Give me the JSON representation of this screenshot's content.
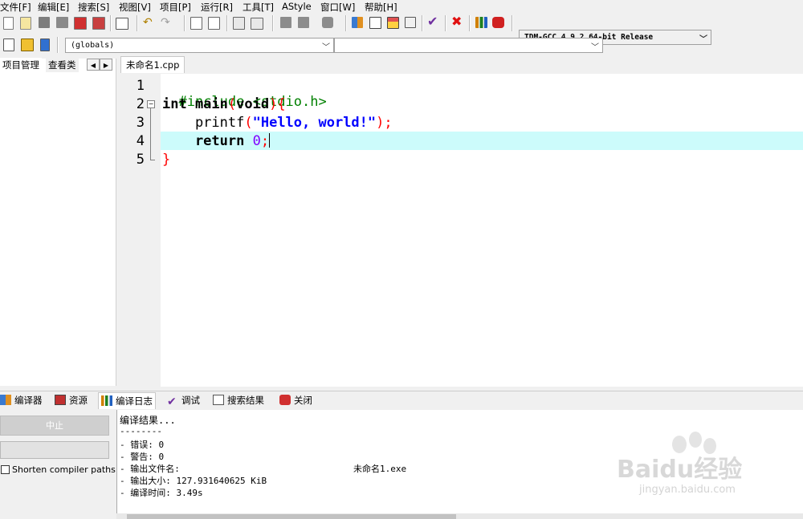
{
  "menu": [
    "文件[F]",
    "编辑[E]",
    "搜索[S]",
    "视图[V]",
    "项目[P]",
    "运行[R]",
    "工具[T]",
    "AStyle",
    "窗口[W]",
    "帮助[H]"
  ],
  "toolbar": {
    "compiler_select": "TDM-GCC 4.9.2 64-bit Release",
    "scope_select": "(globals)",
    "member_select": ""
  },
  "left_panel": {
    "tabs": [
      "项目管理",
      "查看类"
    ]
  },
  "editor": {
    "file_tab": "未命名1.cpp",
    "line_numbers": [
      "1",
      "2",
      "3",
      "4",
      "5"
    ],
    "lines": [
      {
        "t1": "#include <stdio.h>"
      },
      {
        "t1": "int main",
        "t2": "(",
        "t3": "void",
        "t4": ")",
        "t5": "{"
      },
      {
        "t1": "    printf",
        "t2": "(",
        "t3": "\"Hello, world!\"",
        "t4": ");"
      },
      {
        "t1": "    return ",
        "t2": "0",
        "t3": ";"
      },
      {
        "t1": "}"
      }
    ]
  },
  "bottom": {
    "tabs": [
      "编译器",
      "资源",
      "编译日志",
      "调试",
      "搜索结果",
      "关闭"
    ],
    "active_tab": "编译日志",
    "stop_button": "中止",
    "shorten_paths_label": "Shorten compiler paths",
    "shorten_paths_checked": false,
    "log": [
      "编译结果...",
      "--------",
      "- 错误: 0",
      "- 警告: 0",
      "- 输出文件名:",
      "- 输出大小: 127.931640625 KiB",
      "- 编译时间: 3.49s"
    ],
    "output_filename": "未命名1.exe"
  },
  "watermark": {
    "brand": "Baidu经验",
    "url": "jingyan.baidu.com"
  },
  "colors": {
    "preprocessor": "#008000",
    "symbol": "#ff0000",
    "string": "#0000ff",
    "number": "#8000ff",
    "current_line": "#ccfbfb"
  }
}
